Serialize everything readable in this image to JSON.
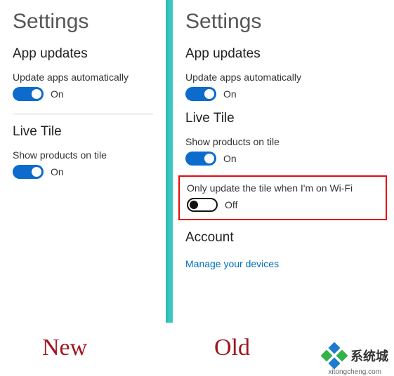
{
  "left": {
    "title": "Settings",
    "sections": [
      {
        "heading": "App updates",
        "settings": [
          {
            "label": "Update apps automatically",
            "state": "On",
            "on": true
          }
        ]
      },
      {
        "heading": "Live Tile",
        "settings": [
          {
            "label": "Show products on tile",
            "state": "On",
            "on": true
          }
        ]
      }
    ]
  },
  "right": {
    "title": "Settings",
    "sections": [
      {
        "heading": "App updates",
        "settings": [
          {
            "label": "Update apps automatically",
            "state": "On",
            "on": true
          }
        ]
      },
      {
        "heading": "Live Tile",
        "settings": [
          {
            "label": "Show products on tile",
            "state": "On",
            "on": true
          },
          {
            "label": "Only update the tile when I'm on Wi-Fi",
            "state": "Off",
            "on": false,
            "highlighted": true
          }
        ]
      },
      {
        "heading": "Account",
        "link": "Manage your devices"
      }
    ]
  },
  "footer": {
    "left_label": "New",
    "right_label": "Old",
    "logo_text": "系统城",
    "logo_url": "xitongcheng.com"
  }
}
